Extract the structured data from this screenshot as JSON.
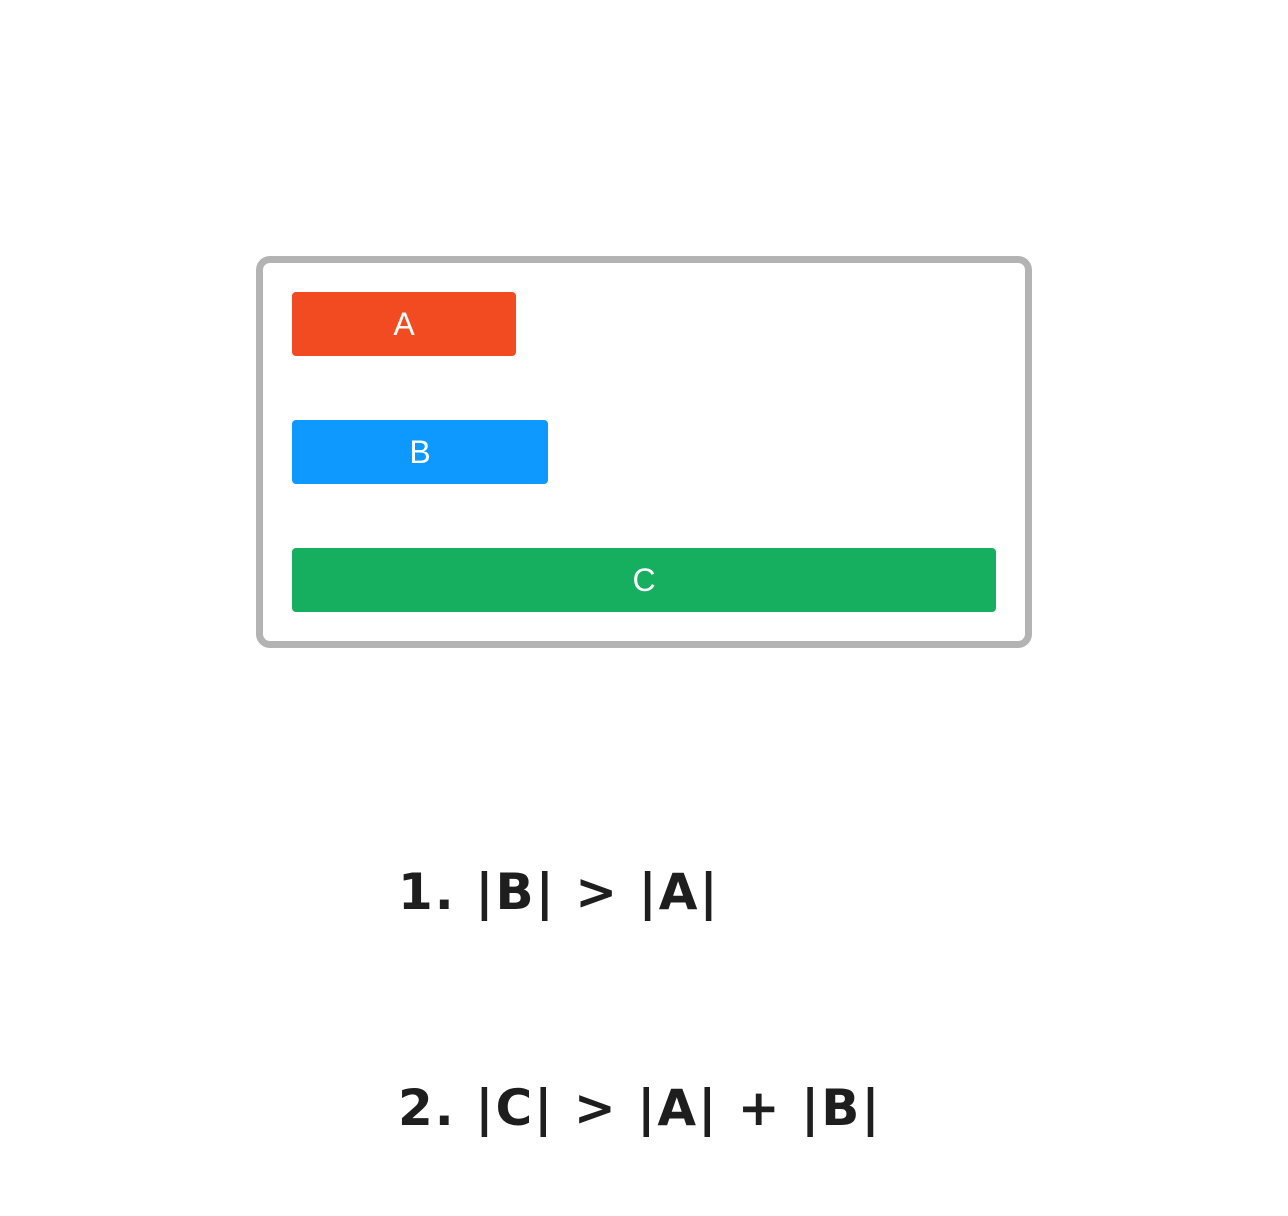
{
  "bars": [
    {
      "label": "A",
      "color": "#f24b22"
    },
    {
      "label": "B",
      "color": "#0d99ff"
    },
    {
      "label": "C",
      "color": "#16ae5f"
    }
  ],
  "rules": [
    "1. |B| > |A|",
    "2. |C| > |A| + |B|"
  ]
}
